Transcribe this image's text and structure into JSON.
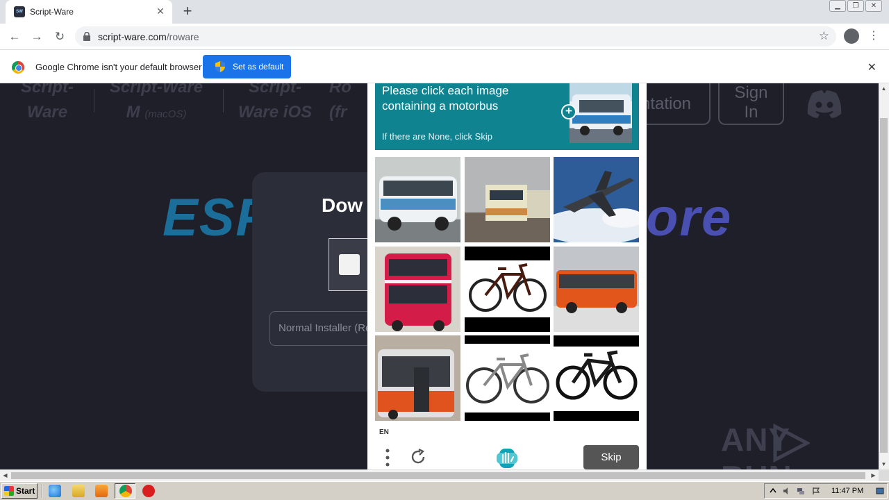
{
  "browser": {
    "tab_title": "Script-Ware",
    "url_host": "script-ware.com",
    "url_path": "/roware",
    "favicon_text": "SW"
  },
  "infobar": {
    "message": "Google Chrome isn't your default browser",
    "button_label": "Set as default"
  },
  "site": {
    "nav": [
      {
        "line1": "Script-",
        "line2": "Ware"
      },
      {
        "line1": "Script-Ware",
        "line2": "M",
        "line2_small": "(macOS)"
      },
      {
        "line1": "Script-",
        "line2": "Ware iOS"
      },
      {
        "line1": "Ro",
        "line2": "(fr"
      }
    ],
    "documentation_label": "ntation",
    "signin_line1": "Sign",
    "signin_line2": "In",
    "hero_left": "ESP",
    "hero_right": "ore",
    "download_title": "Dow",
    "installer_placeholder": "Normal Installer (Re"
  },
  "captcha": {
    "prompt_line1": "Please click each image",
    "prompt_line2": "containing a motorbus",
    "prompt_sub": "If there are None, click Skip",
    "language": "EN",
    "skip_label": "Skip",
    "tiles": [
      {
        "name": "tile-coach-bus",
        "subject": "bus"
      },
      {
        "name": "tile-train",
        "subject": "train"
      },
      {
        "name": "tile-airplane",
        "subject": "airplane"
      },
      {
        "name": "tile-double-decker-bus",
        "subject": "bus"
      },
      {
        "name": "tile-bicycle-1",
        "subject": "bicycle"
      },
      {
        "name": "tile-orange-bus",
        "subject": "bus"
      },
      {
        "name": "tile-red-city-bus",
        "subject": "bus"
      },
      {
        "name": "tile-bicycle-2",
        "subject": "bicycle"
      },
      {
        "name": "tile-bicycle-3",
        "subject": "bicycle"
      }
    ]
  },
  "watermark": {
    "left": "ANY",
    "right": "RUN"
  },
  "taskbar": {
    "start_label": "Start",
    "clock": "11:47 PM"
  },
  "colors": {
    "captcha_teal": "#0f8390",
    "chrome_blue": "#1a73e8",
    "page_bg": "#1e1f29"
  }
}
